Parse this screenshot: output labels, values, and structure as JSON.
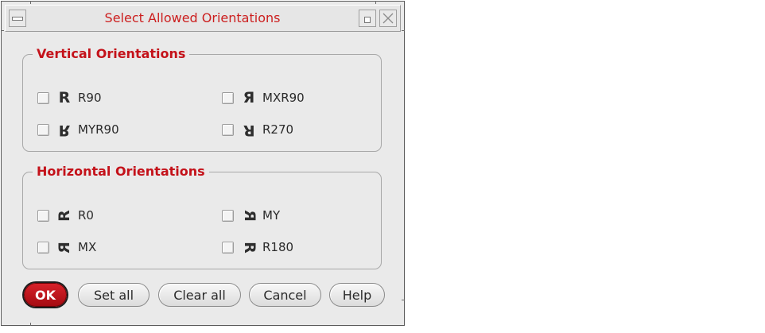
{
  "window": {
    "title": "Select Allowed Orientations",
    "controls": {
      "menu_icon": "window-menu-icon",
      "iconify_icon": "iconify-icon",
      "close_icon": "close-icon"
    }
  },
  "vertical": {
    "title": "Vertical Orientations",
    "options": [
      {
        "label": "R90",
        "glyph": "R",
        "checked": false
      },
      {
        "label": "MXR90",
        "glyph": "Я",
        "checked": false
      },
      {
        "label": "MYR90",
        "glyph": "R",
        "checked": false
      },
      {
        "label": "R270",
        "glyph": "R",
        "checked": false
      }
    ]
  },
  "horizontal": {
    "title": "Horizontal Orientations",
    "options": [
      {
        "label": "R0",
        "glyph": "R",
        "checked": false
      },
      {
        "label": "MY",
        "glyph": "R",
        "checked": false
      },
      {
        "label": "MX",
        "glyph": "R",
        "checked": false
      },
      {
        "label": "R180",
        "glyph": "R",
        "checked": false
      }
    ]
  },
  "buttons": {
    "ok": "OK",
    "set_all": "Set all",
    "clear_all": "Clear all",
    "cancel": "Cancel",
    "help": "Help"
  },
  "colors": {
    "title_text": "#cc1f1f",
    "group_title": "#c4121a",
    "ok_button": "#b8141b",
    "window_bg": "#eaeaea"
  }
}
